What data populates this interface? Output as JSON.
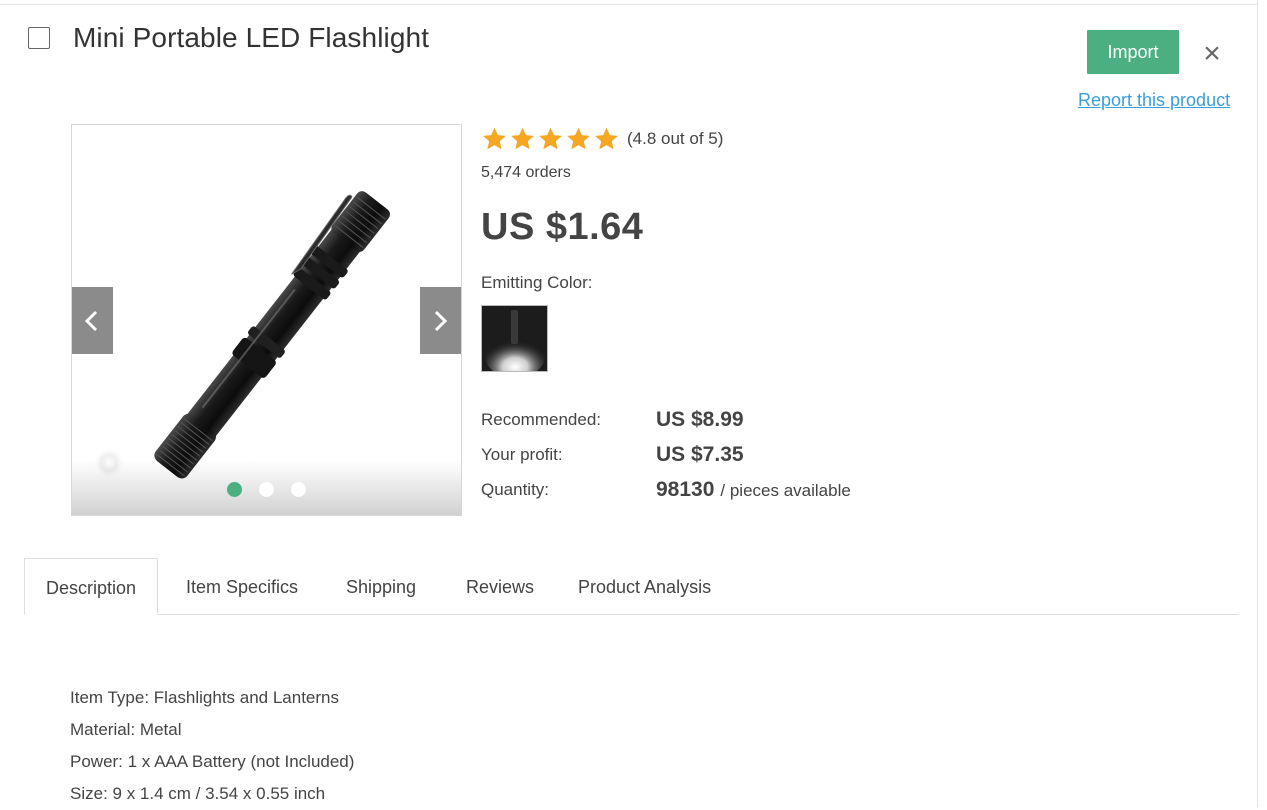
{
  "product": {
    "title": "Mini Portable LED Flashlight",
    "rating_text": "(4.8 out of 5)",
    "rating_value": 4.8,
    "rating_max": 5,
    "orders": "5,474 orders",
    "price": "US $1.64"
  },
  "actions": {
    "import_label": "Import",
    "close_symbol": "×",
    "report_label": "Report this product"
  },
  "gallery": {
    "slide_count": 3,
    "active_slide": 0
  },
  "variant": {
    "label": "Emitting Color:"
  },
  "pricing": {
    "recommended_label": "Recommended:",
    "recommended_value": "US $8.99",
    "profit_label": "Your profit:",
    "profit_value": "US $7.35",
    "quantity_label": "Quantity:",
    "quantity_value": "98130",
    "quantity_suffix": "/ pieces available"
  },
  "tabs": [
    {
      "label": "Description",
      "active": true
    },
    {
      "label": "Item Specifics",
      "active": false
    },
    {
      "label": "Shipping",
      "active": false
    },
    {
      "label": "Reviews",
      "active": false
    },
    {
      "label": "Product Analysis",
      "active": false
    }
  ],
  "description": [
    "Item Type: Flashlights and Lanterns",
    "Material: Metal",
    "Power: 1 x AAA Battery (not Included)",
    "Size: 9 x 1.4 cm / 3.54 x 0.55 inch"
  ],
  "colors": {
    "accent": "#4caf82",
    "link": "#3b9edb",
    "star": "#f5a623"
  }
}
